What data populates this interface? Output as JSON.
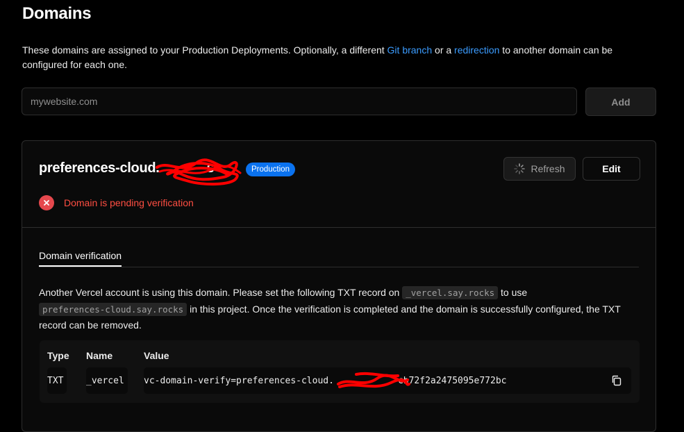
{
  "page": {
    "title": "Domains",
    "intro_before": "These domains are assigned to your Production Deployments. Optionally, a different ",
    "intro_link1": "Git branch",
    "intro_mid": " or a ",
    "intro_link2": "redirection",
    "intro_after": " to another domain can be configured for each one."
  },
  "add_domain": {
    "placeholder": "mywebsite.com",
    "button_label": "Add"
  },
  "domain": {
    "name": "preferences-cloud.",
    "name_tail": "s",
    "badge": "Production",
    "refresh_label": "Refresh",
    "edit_label": "Edit",
    "status_text": "Domain is pending verification"
  },
  "verification": {
    "tab_label": "Domain verification",
    "text_1": "Another Vercel account is using this domain. Please set the following TXT record on ",
    "code_1": "_vercel.say.rocks",
    "text_2": " to use ",
    "code_2": "preferences-cloud.say.rocks",
    "text_3": " in this project. Once the verification is completed and the domain is successfully configured, the TXT record can be removed."
  },
  "record": {
    "headers": {
      "type": "Type",
      "name": "Name",
      "value": "Value"
    },
    "type": "TXT",
    "name": "_vercel",
    "value_prefix": "vc-domain-verify=preferences-cloud.",
    "value_suffix": "cb72f2a2475095e772bc"
  },
  "colors": {
    "accent_link": "#3b9cff",
    "badge_bg": "#0a72ef",
    "error": "#e5484d",
    "redaction": "#ff0000"
  },
  "icons": [
    "spinner-icon",
    "error-x-icon",
    "copy-icon"
  ]
}
